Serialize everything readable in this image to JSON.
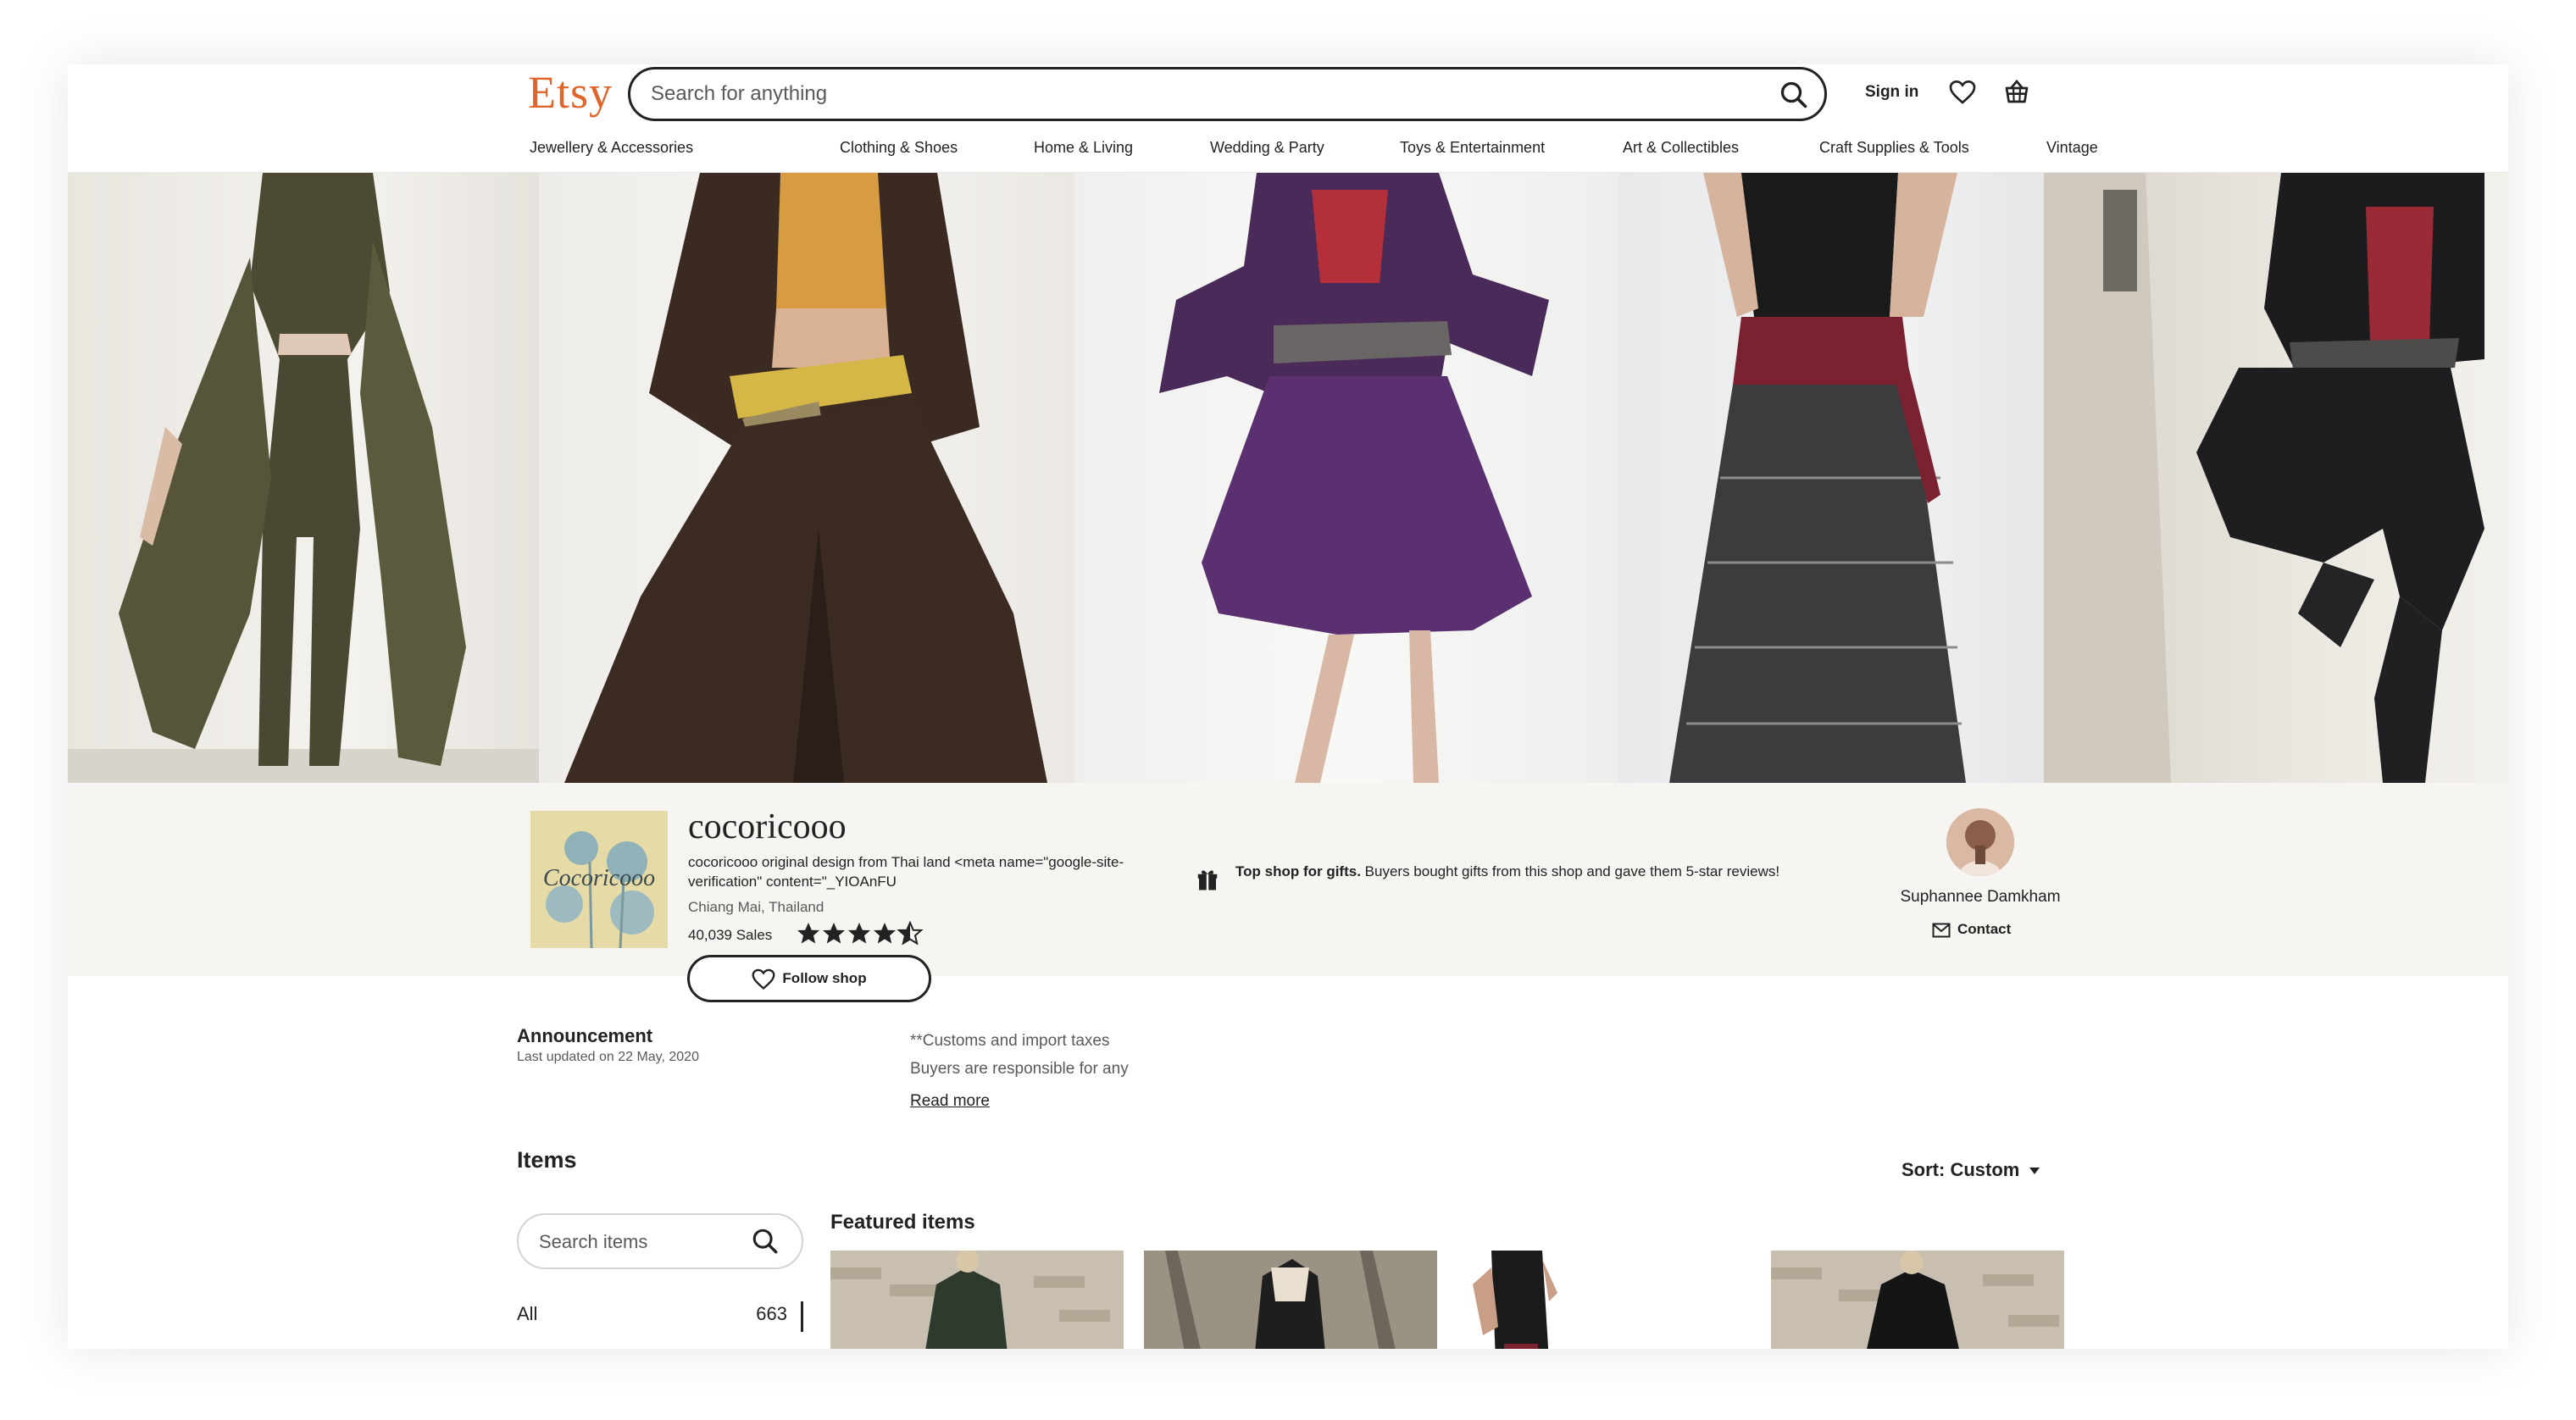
{
  "brand": {
    "logo": "Etsy",
    "accent": "#e0652b"
  },
  "header": {
    "search_placeholder": "Search for anything",
    "sign_in": "Sign in",
    "icons": [
      "search-icon",
      "heart-icon",
      "basket-icon"
    ]
  },
  "nav": {
    "items": [
      "Jewellery & Accessories",
      "Clothing & Shoes",
      "Home & Living",
      "Wedding & Party",
      "Toys & Entertainment",
      "Art & Collectibles",
      "Craft Supplies & Tools",
      "Vintage"
    ]
  },
  "shop": {
    "logo_text": "Cocoricooo",
    "name": "cocoricooo",
    "description": "cocoricooo original design from Thai land <meta name=\"google-site-verification\" content=\"_YIOAnFU",
    "location": "Chiang Mai, Thailand",
    "sales": "40,039 Sales",
    "rating": 4.5,
    "follow_label": "Follow shop",
    "gift_bold": "Top shop for gifts.",
    "gift_text": " Buyers bought gifts from this shop and gave them 5-star reviews!",
    "owner_name": "Suphannee Damkham",
    "contact_label": "Contact"
  },
  "announcement": {
    "title": "Announcement",
    "date": "Last updated on 22 May, 2020",
    "line1": "**Customs and import taxes",
    "line2": "Buyers are responsible for any",
    "read_more": "Read more"
  },
  "items": {
    "title": "Items",
    "sort_label": "Sort: Custom",
    "search_placeholder": "Search items",
    "categories": [
      {
        "label": "All",
        "count": "663"
      }
    ],
    "featured_title": "Featured items"
  }
}
